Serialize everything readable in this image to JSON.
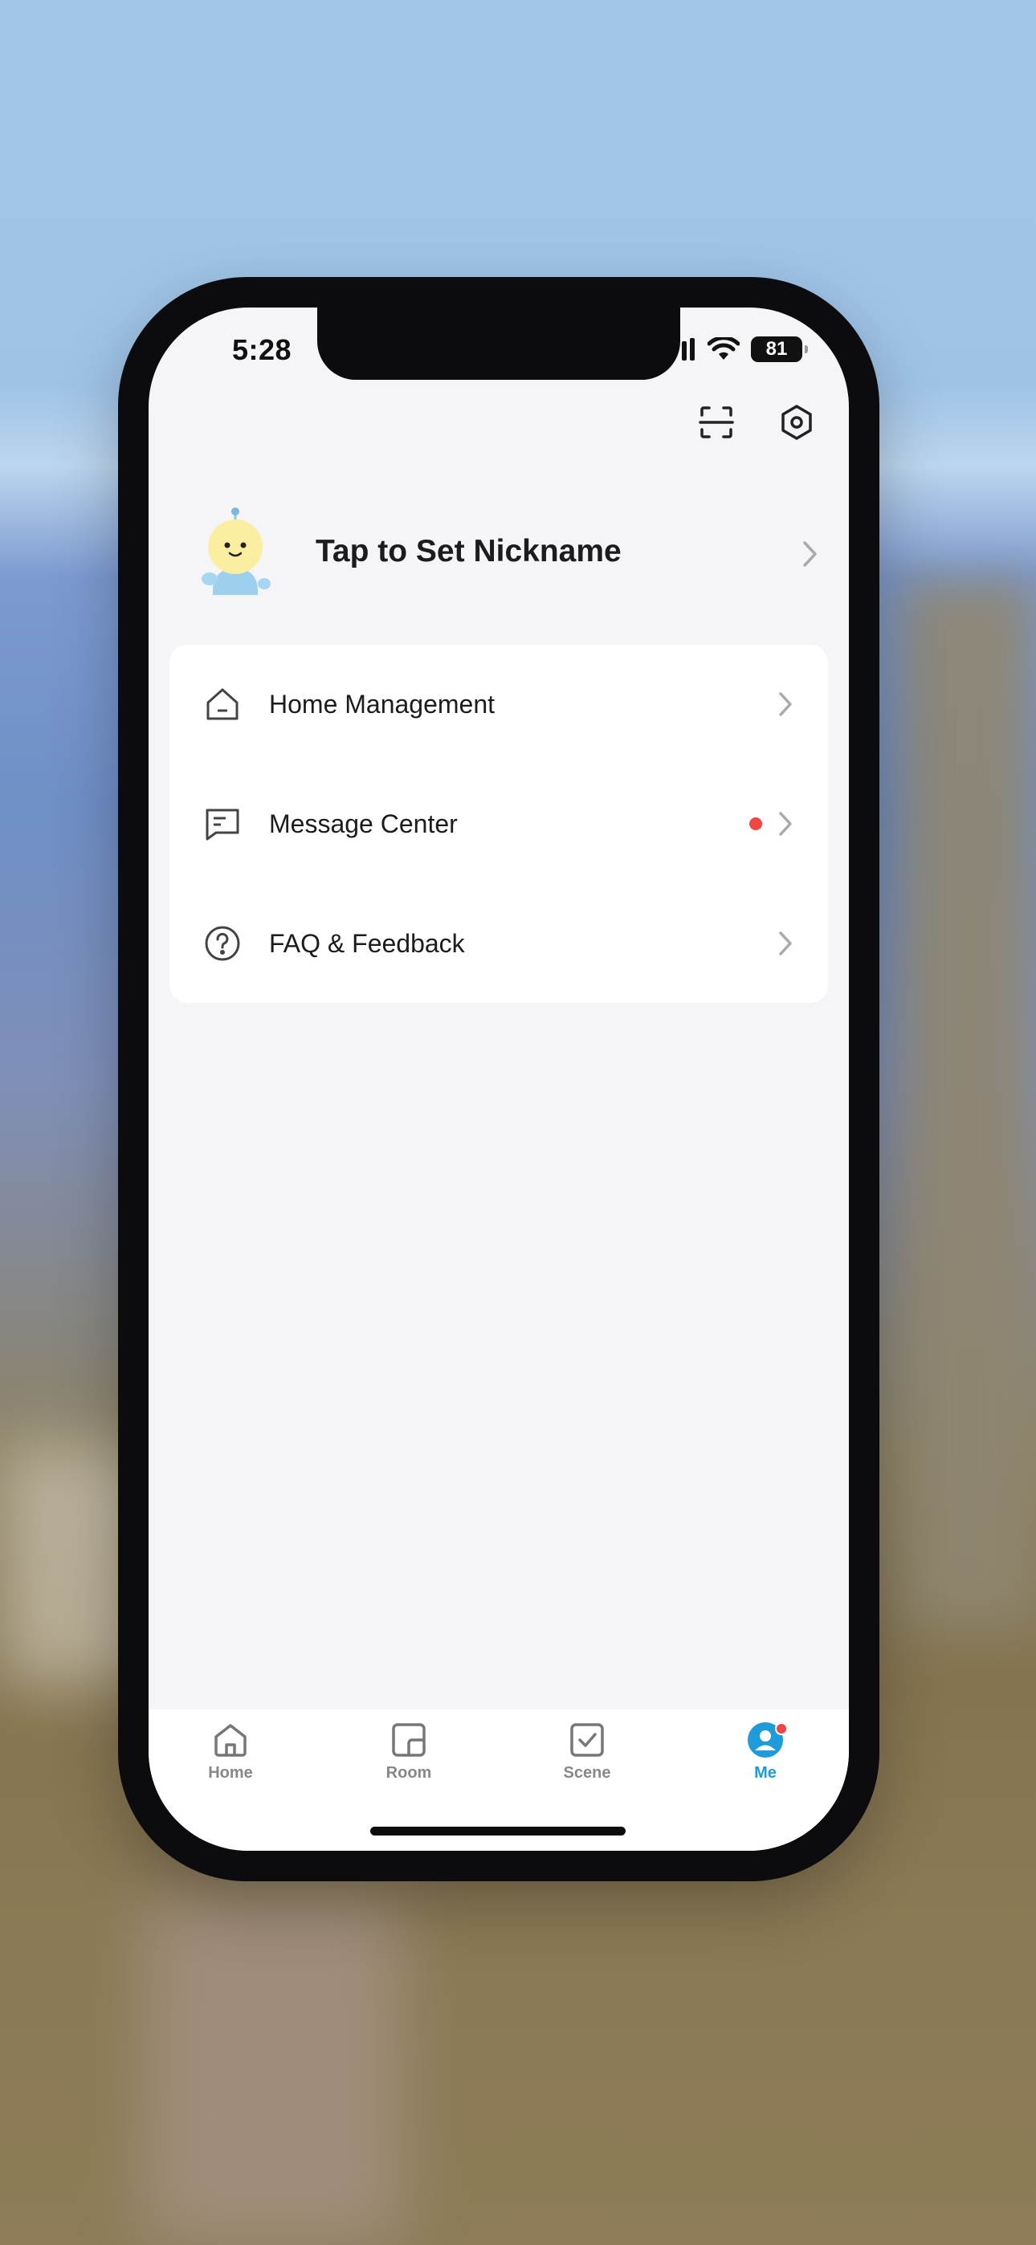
{
  "status_bar": {
    "time": "5:28",
    "battery": "81"
  },
  "header": {
    "icons": [
      "scan-icon",
      "settings-gear-icon"
    ]
  },
  "profile": {
    "nickname": "Tap to Set Nickname",
    "avatar": "robot-mascot-avatar"
  },
  "menu": {
    "items": [
      {
        "label": "Home Management",
        "icon": "house-icon",
        "badge": false
      },
      {
        "label": "Message Center",
        "icon": "message-icon",
        "badge": true
      },
      {
        "label": "FAQ & Feedback",
        "icon": "question-circle-icon",
        "badge": false
      }
    ]
  },
  "tabbar": {
    "tabs": [
      {
        "label": "Home",
        "icon": "home-tab-icon",
        "active": false
      },
      {
        "label": "Room",
        "icon": "room-tab-icon",
        "active": false
      },
      {
        "label": "Scene",
        "icon": "scene-tab-icon",
        "active": false
      },
      {
        "label": "Me",
        "icon": "me-tab-icon",
        "active": true,
        "badge": true
      }
    ]
  },
  "colors": {
    "accent": "#1e9bdb",
    "badge": "#ef4545",
    "background": "#f5f4f7"
  }
}
